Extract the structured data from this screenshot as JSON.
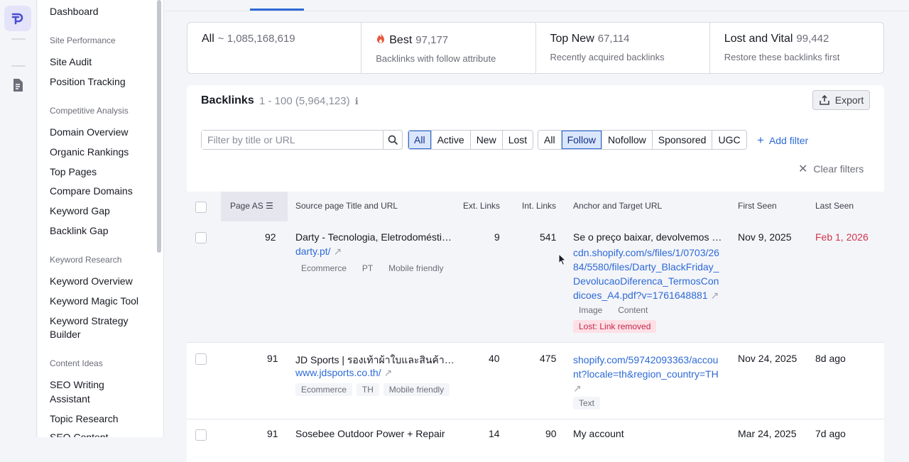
{
  "sidebar": {
    "items": [
      {
        "label": "Dashboard"
      },
      {
        "section": "Site Performance"
      },
      {
        "label": "Site Audit"
      },
      {
        "label": "Position Tracking"
      },
      {
        "section": "Competitive Analysis"
      },
      {
        "label": "Domain Overview"
      },
      {
        "label": "Organic Rankings"
      },
      {
        "label": "Top Pages"
      },
      {
        "label": "Compare Domains"
      },
      {
        "label": "Keyword Gap"
      },
      {
        "label": "Backlink Gap"
      },
      {
        "section": "Keyword Research"
      },
      {
        "label": "Keyword Overview"
      },
      {
        "label": "Keyword Magic Tool"
      },
      {
        "label": "Keyword Strategy"
      },
      {
        "label": "Builder"
      },
      {
        "section": "Content Ideas"
      },
      {
        "label": "SEO Writing"
      },
      {
        "label": "Assistant"
      },
      {
        "label": "Topic Research"
      },
      {
        "label": "SEO Content"
      }
    ]
  },
  "cards": [
    {
      "title": "All",
      "count": "~ 1,085,168,619",
      "desc": ""
    },
    {
      "title": "Best",
      "count": "97,177",
      "desc": "Backlinks with follow attribute",
      "icon": "fire-icon"
    },
    {
      "title": "Top New",
      "count": "67,114",
      "desc": "Recently acquired backlinks"
    },
    {
      "title": "Lost and Vital",
      "count": "99,442",
      "desc": "Restore these backlinks first"
    }
  ],
  "panel": {
    "title": "Backlinks",
    "range": "1 - 100 (5,964,123)",
    "export_label": "Export",
    "search_placeholder": "Filter by title or URL",
    "status_filters": [
      "All",
      "Active",
      "New",
      "Lost"
    ],
    "status_selected": "All",
    "type_filters": [
      "All",
      "Follow",
      "Nofollow",
      "Sponsored",
      "UGC"
    ],
    "type_selected": "Follow",
    "add_filter_label": "Add filter",
    "clear_filters_label": "Clear filters"
  },
  "table": {
    "columns": [
      "Page AS",
      "Source page Title and URL",
      "Ext. Links",
      "Int. Links",
      "Anchor and Target URL",
      "First Seen",
      "Last Seen"
    ],
    "rows": [
      {
        "page_as": "92",
        "title": "Darty - Tecnologia, Eletrodomésti…",
        "url": "darty.pt/",
        "tags": [
          "Ecommerce",
          "PT",
          "Mobile friendly"
        ],
        "ext_links": "9",
        "int_links": "541",
        "anchor": "Se o preço baixar, devolvemos …",
        "target_lines": [
          "cdn.shopify.com/s/files/1/0703/26",
          "84/5580/files/Darty_BlackFriday_",
          "DevolucaoDiferenca_TermosCon",
          "dicoes_A4.pdf?v=1761648881"
        ],
        "anchor_tags": [
          "Image",
          "Content"
        ],
        "status_tag": "Lost: Link removed",
        "first_seen": "Nov 9, 2025",
        "last_seen": "Feb 1, 2026",
        "last_seen_color": "#d1344f"
      },
      {
        "page_as": "91",
        "title": "JD Sports | รองเท้าผ้าใบและสินค้า…",
        "url": "www.jdsports.co.th/",
        "tags": [
          "Ecommerce",
          "TH",
          "Mobile friendly"
        ],
        "ext_links": "40",
        "int_links": "475",
        "anchor": "",
        "target_lines": [
          "shopify.com/59742093363/accou",
          "nt?locale=th&region_country=TH"
        ],
        "anchor_tags": [
          "Text"
        ],
        "first_seen": "Nov 24, 2025",
        "last_seen": "8d ago"
      },
      {
        "page_as": "91",
        "title": "Sosebee Outdoor Power + Repair",
        "ext_links": "14",
        "int_links": "90",
        "anchor": "My account",
        "first_seen": "Mar 24, 2025",
        "last_seen": "7d ago"
      }
    ]
  }
}
